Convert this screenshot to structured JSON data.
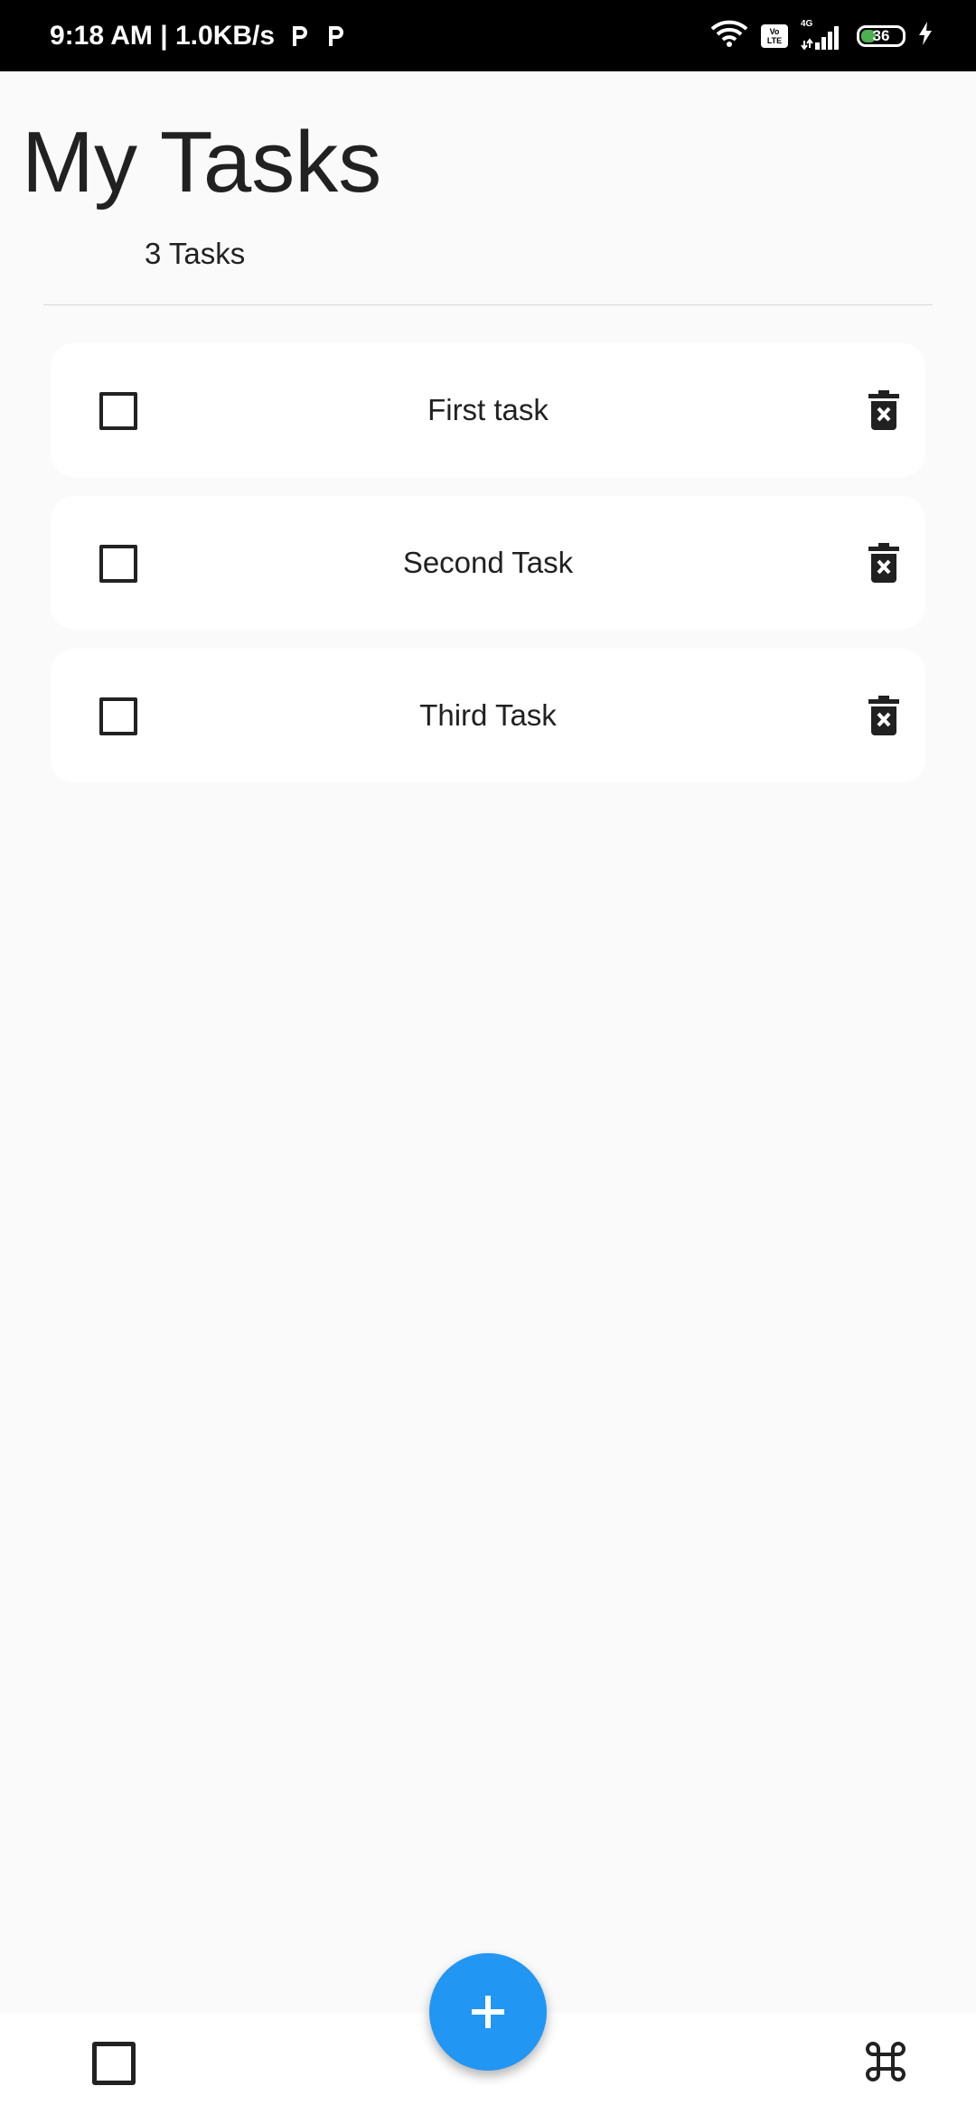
{
  "status_bar": {
    "time_speed": "9:18 AM | 1.0KB/s",
    "network_type": "4G",
    "volte_top": "Vo",
    "volte_bottom": "LTE",
    "battery_level": "36",
    "battery_fraction": 0.36
  },
  "header": {
    "title": "My Tasks",
    "count": "3 Tasks"
  },
  "tasks": [
    {
      "title": "First task",
      "checked": false
    },
    {
      "title": "Second Task",
      "checked": false
    },
    {
      "title": "Third Task",
      "checked": false
    }
  ],
  "colors": {
    "accent": "#2196f3",
    "background": "#fafafa",
    "card": "#ffffff",
    "text": "#212121"
  },
  "icons": {
    "delete": "delete-forever-icon",
    "add": "plus-icon",
    "command": "command-icon",
    "checkbox": "checkbox-outline-icon"
  }
}
